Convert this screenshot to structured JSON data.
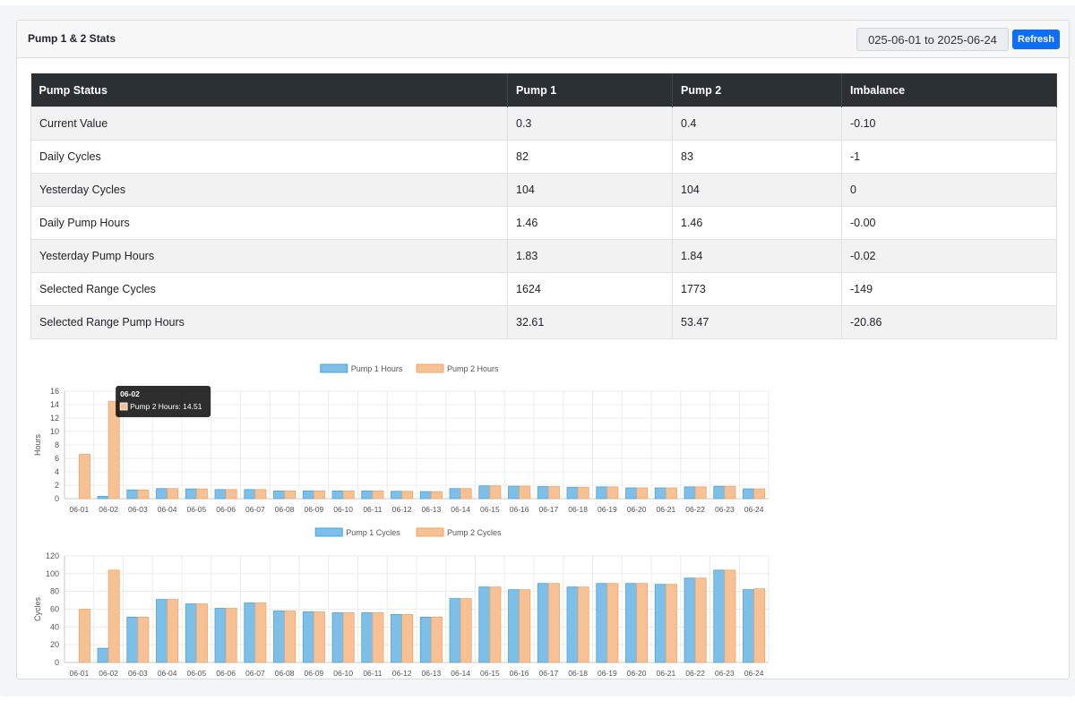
{
  "card": {
    "title": "Pump 1 & 2 Stats",
    "date_range": "025-06-01 to 2025-06-24",
    "refresh_label": "Refresh"
  },
  "table": {
    "headers": [
      "Pump Status",
      "Pump 1",
      "Pump 2",
      "Imbalance"
    ],
    "rows": [
      [
        "Current Value",
        "0.3",
        "0.4",
        "-0.10"
      ],
      [
        "Daily Cycles",
        "82",
        "83",
        "-1"
      ],
      [
        "Yesterday Cycles",
        "104",
        "104",
        "0"
      ],
      [
        "Daily Pump Hours",
        "1.46",
        "1.46",
        "-0.00"
      ],
      [
        "Yesterday Pump Hours",
        "1.83",
        "1.84",
        "-0.02"
      ],
      [
        "Selected Range Cycles",
        "1624",
        "1773",
        "-149"
      ],
      [
        "Selected Range Pump Hours",
        "32.61",
        "53.47",
        "-20.86"
      ]
    ]
  },
  "colors": {
    "pump1": "#7cbfe9",
    "pump1_border": "#4aa3df",
    "pump2": "#f8c193",
    "pump2_border": "#f0a66a"
  },
  "chart_data": [
    {
      "type": "bar",
      "ylabel": "Hours",
      "ylim": [
        0,
        16
      ],
      "yticks": [
        0,
        2,
        4,
        6,
        8,
        10,
        12,
        14,
        16
      ],
      "legend_position": "top",
      "categories": [
        "06-01",
        "06-02",
        "06-03",
        "06-04",
        "06-05",
        "06-06",
        "06-07",
        "06-08",
        "06-09",
        "06-10",
        "06-11",
        "06-12",
        "06-13",
        "06-14",
        "06-15",
        "06-16",
        "06-17",
        "06-18",
        "06-19",
        "06-20",
        "06-21",
        "06-22",
        "06-23",
        "06-24"
      ],
      "series": [
        {
          "name": "Pump 1 Hours",
          "values": [
            0,
            0.35,
            1.3,
            1.5,
            1.45,
            1.35,
            1.35,
            1.15,
            1.15,
            1.15,
            1.15,
            1.1,
            1.05,
            1.5,
            1.9,
            1.85,
            1.8,
            1.7,
            1.75,
            1.6,
            1.6,
            1.75,
            1.83,
            1.46
          ]
        },
        {
          "name": "Pump 2 Hours",
          "values": [
            6.6,
            14.51,
            1.3,
            1.5,
            1.45,
            1.35,
            1.35,
            1.15,
            1.15,
            1.15,
            1.15,
            1.1,
            1.05,
            1.5,
            1.9,
            1.85,
            1.8,
            1.7,
            1.75,
            1.6,
            1.6,
            1.75,
            1.84,
            1.46
          ]
        }
      ],
      "tooltip": {
        "title": "06-02",
        "body": "Pump 2 Hours: 14.51"
      }
    },
    {
      "type": "bar",
      "ylabel": "Cycles",
      "ylim": [
        0,
        120
      ],
      "yticks": [
        0,
        20,
        40,
        60,
        80,
        100,
        120
      ],
      "legend_position": "top",
      "categories": [
        "06-01",
        "06-02",
        "06-03",
        "06-04",
        "06-05",
        "06-06",
        "06-07",
        "06-08",
        "06-09",
        "06-10",
        "06-11",
        "06-12",
        "06-13",
        "06-14",
        "06-15",
        "06-16",
        "06-17",
        "06-18",
        "06-19",
        "06-20",
        "06-21",
        "06-22",
        "06-23",
        "06-24"
      ],
      "series": [
        {
          "name": "Pump 1 Cycles",
          "values": [
            0,
            16,
            51,
            71,
            66,
            61,
            67,
            58,
            57,
            56,
            56,
            54,
            51,
            72,
            85,
            82,
            89,
            85,
            89,
            89,
            88,
            95,
            104,
            82
          ]
        },
        {
          "name": "Pump 2 Cycles",
          "values": [
            60,
            104,
            51,
            71,
            66,
            61,
            67,
            58,
            57,
            56,
            56,
            54,
            51,
            72,
            85,
            82,
            89,
            85,
            89,
            89,
            88,
            95,
            104,
            83
          ]
        }
      ]
    }
  ]
}
